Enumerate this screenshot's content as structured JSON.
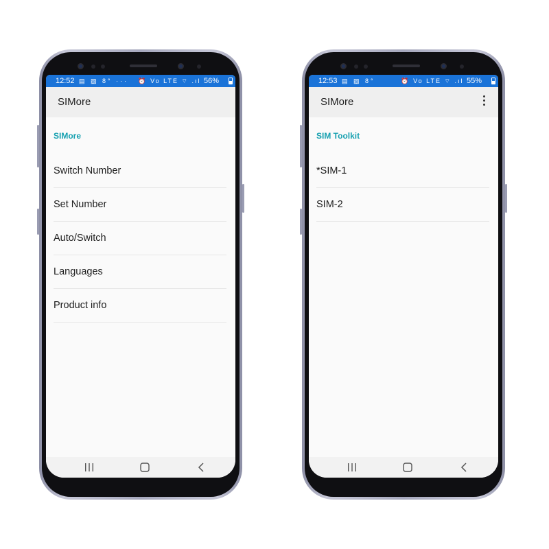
{
  "phones": [
    {
      "status": {
        "time": "12:52",
        "left_icons": "▤ ▨ 8° ···",
        "right_icons": "⏰ Vo LTE ⌔ .ıl",
        "battery": "56%"
      },
      "appbar": {
        "title": "SIMore",
        "has_menu": false
      },
      "section_header": "SIMore",
      "items": [
        {
          "label": "Switch Number"
        },
        {
          "label": "Set Number"
        },
        {
          "label": "Auto/Switch"
        },
        {
          "label": "Languages"
        },
        {
          "label": "Product info"
        }
      ]
    },
    {
      "status": {
        "time": "12:53",
        "left_icons": "▤ ▨ 8°",
        "right_icons": "⏰ Vo LTE ⌔ .ıl",
        "battery": "55%"
      },
      "appbar": {
        "title": "SIMore",
        "has_menu": true,
        "menu_icon": "more-vert-icon"
      },
      "section_header": "SIM Toolkit",
      "items": [
        {
          "label": "*SIM-1"
        },
        {
          "label": "SIM-2"
        }
      ]
    }
  ],
  "navbar": {
    "icons": [
      "recents-icon",
      "home-icon",
      "back-icon"
    ]
  },
  "colors": {
    "statusbar": "#1a73d8",
    "section_header": "#16a0b0",
    "appbar": "#efefef",
    "screen": "#fafafa"
  }
}
